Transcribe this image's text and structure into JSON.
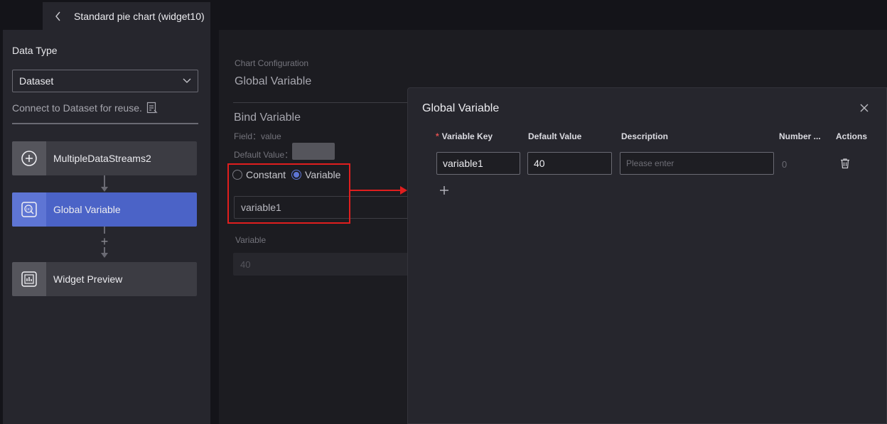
{
  "header": {
    "back_icon": "chevron-left-icon",
    "title": "Standard pie chart (widget10)"
  },
  "left_panel": {
    "data_type_label": "Data Type",
    "data_type_value": "Dataset",
    "connect_text": "Connect to Dataset for reuse.",
    "nodes": [
      {
        "label": "MultipleDataStreams2",
        "icon": "plus-circle-icon"
      },
      {
        "label": "Global Variable",
        "icon": "variable-icon",
        "active": true
      },
      {
        "label": "Widget Preview",
        "icon": "chart-preview-icon"
      }
    ],
    "add_node_symbol": "+"
  },
  "config": {
    "subtitle": "Chart Configuration",
    "title": "Global Variable",
    "bind_title": "Bind Variable",
    "field_text": "Field：value",
    "default_value_label": "Default Value：",
    "radio_constant": "Constant",
    "radio_variable": "Variable",
    "selected_variable": "variable1",
    "variable_label": "Variable",
    "variable_value": "40"
  },
  "modal": {
    "title": "Global Variable",
    "columns": {
      "key": "Variable Key",
      "default": "Default Value",
      "description": "Description",
      "number": "Number ...",
      "actions": "Actions"
    },
    "required_mark": "*",
    "rows": [
      {
        "key": "variable1",
        "default": "40",
        "description_placeholder": "Please enter",
        "number": "0"
      }
    ]
  },
  "colors": {
    "accent": "#4b63c7",
    "highlight_box": "#e01e1e"
  }
}
